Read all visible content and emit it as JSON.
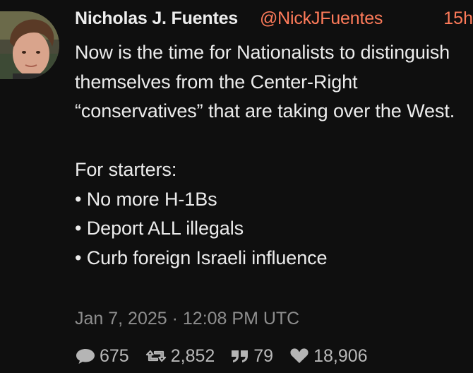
{
  "author": {
    "name": "Nicholas J. Fuentes",
    "handle": "@NickJFuentes",
    "age": "15h"
  },
  "post": {
    "paragraph": "Now is the time for Nationalists to distinguish themselves from the Center-Right “conservatives” that are taking over the West.",
    "intro": "For starters:",
    "bullets": [
      "• No more H-1Bs",
      "• Deport ALL illegals",
      "• Curb foreign Israeli influence"
    ],
    "timestamp": "Jan 7, 2025 · 12:08 PM UTC"
  },
  "stats": {
    "replies": "675",
    "retweets": "2,852",
    "quotes": "79",
    "likes": "18,906"
  },
  "colors": {
    "background": "#0f0f0f",
    "accent": "#ff7b5a",
    "text": "#ececec",
    "muted": "#8e8e8e"
  }
}
